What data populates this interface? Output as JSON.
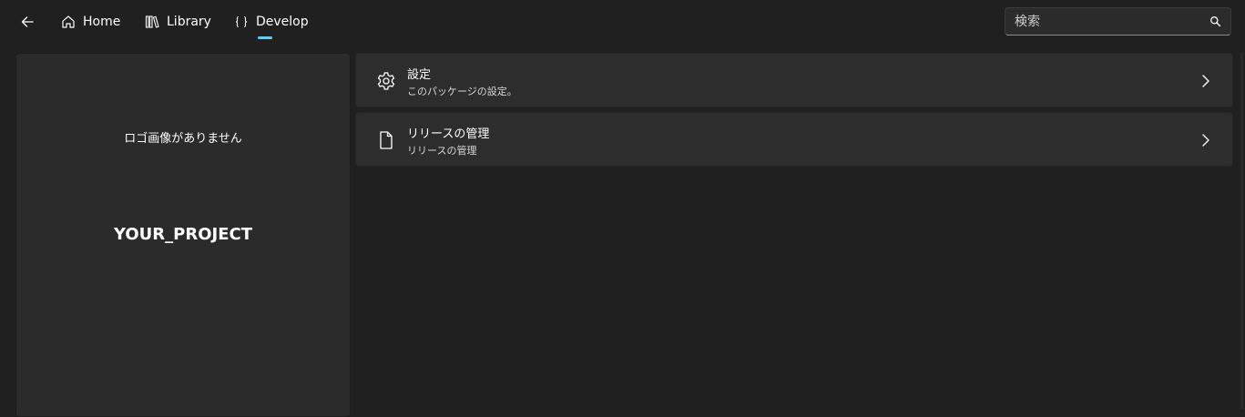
{
  "topbar": {
    "back_icon": "back-arrow-icon",
    "tabs": [
      {
        "label": "Home",
        "icon": "home-icon"
      },
      {
        "label": "Library",
        "icon": "library-icon"
      },
      {
        "label": "Develop",
        "icon": "braces-icon",
        "selected": true
      }
    ],
    "search": {
      "placeholder": "検索",
      "value": "",
      "icon": "search-icon"
    }
  },
  "project": {
    "logo_placeholder": "ロゴ画像がありません",
    "name": "YOUR_PROJECT"
  },
  "cards": [
    {
      "title": "設定",
      "subtitle": "このパッケージの設定。",
      "icon": "gear-icon"
    },
    {
      "title": "リリースの管理",
      "subtitle": "リリースの管理",
      "icon": "document-icon"
    }
  ],
  "colors": {
    "background": "#202020",
    "panel": "#2b2b2b",
    "card": "#2d2d2d",
    "accent": "#60cdff"
  }
}
